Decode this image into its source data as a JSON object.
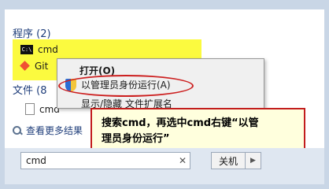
{
  "programs": {
    "header": "程序 (2)",
    "items": [
      {
        "label": "cmd",
        "icon": "cmd-icon"
      },
      {
        "label": "Git",
        "icon": "git-icon"
      }
    ]
  },
  "files": {
    "header": "文件 (8",
    "items": [
      {
        "label": "cmd",
        "icon": "file-icon"
      }
    ]
  },
  "more_results": "查看更多结果",
  "context_menu": {
    "open": "打开(O)",
    "run_as_admin": "以管理员身份运行(A)",
    "ext_label": "显示/隐藏 文件扩展名"
  },
  "callout": {
    "line1": "搜索cmd，再选中cmd右键“以管",
    "line2": "理员身份运行”"
  },
  "search": {
    "value": "cmd",
    "clear": "✕"
  },
  "shutdown": {
    "label": "关机",
    "arrow": "▶"
  },
  "colors": {
    "highlight": "#fbfa35",
    "annotation_red": "#c21d1d",
    "callout_bg": "#ffffdd"
  }
}
